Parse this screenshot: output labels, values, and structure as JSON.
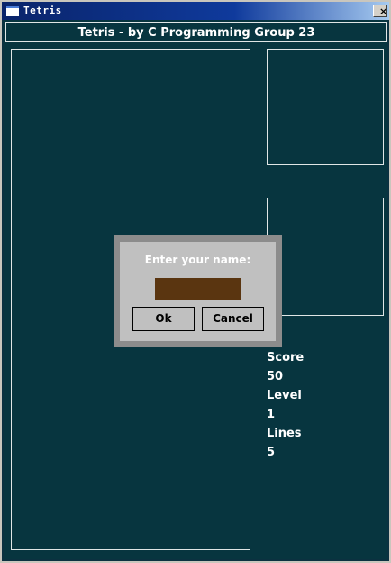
{
  "window": {
    "title": "Tetris",
    "close_label": "×"
  },
  "header": {
    "text": "Tetris - by C Programming Group 23"
  },
  "stats": {
    "score_label": "Score",
    "score_value": "50",
    "level_label": "Level",
    "level_value": "1",
    "lines_label": "Lines",
    "lines_value": "5"
  },
  "dialog": {
    "prompt": "Enter your name:",
    "name_value": "",
    "ok_label": "Ok",
    "cancel_label": "Cancel"
  },
  "colors": {
    "background": "#07353f",
    "input_fill": "#5a3510",
    "dialog_face": "#c0c0c0"
  }
}
